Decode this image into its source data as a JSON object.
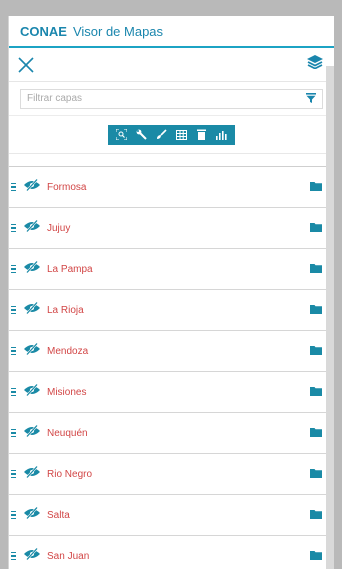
{
  "header": {
    "brand": "CONAE",
    "title": "Visor de Mapas"
  },
  "search": {
    "placeholder": "Filtrar capas",
    "value": ""
  },
  "toolbar": {
    "close_icon": "close-icon",
    "layers_icon": "layers-icon"
  },
  "tools": [
    {
      "icon": "zoom-extent-icon"
    },
    {
      "icon": "wrench-icon"
    },
    {
      "icon": "brush-icon"
    },
    {
      "icon": "table-icon"
    },
    {
      "icon": "trash-icon"
    },
    {
      "icon": "bar-chart-icon"
    }
  ],
  "layers": [
    {
      "name": "Formosa"
    },
    {
      "name": "Jujuy"
    },
    {
      "name": "La Pampa"
    },
    {
      "name": "La Rioja"
    },
    {
      "name": "Mendoza"
    },
    {
      "name": "Misiones"
    },
    {
      "name": "Neuquén"
    },
    {
      "name": "Rio Negro"
    },
    {
      "name": "Salta"
    },
    {
      "name": "San Juan"
    }
  ],
  "colors": {
    "accent": "#1a8aa6",
    "header_text": "#1a86ad",
    "layer_text": "#d24646",
    "background": "#b9b9b9"
  }
}
